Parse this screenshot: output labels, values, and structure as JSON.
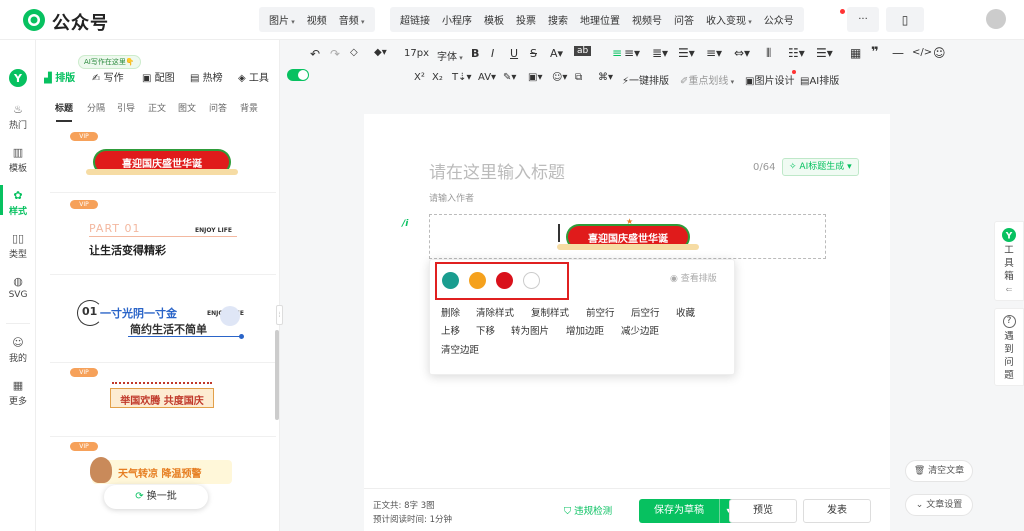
{
  "brand": {
    "name": "公众号",
    "accent": "#07c160"
  },
  "topnav": {
    "group1": [
      {
        "label": "图片",
        "caret": true
      },
      {
        "label": "视频",
        "caret": false
      },
      {
        "label": "音频",
        "caret": true
      }
    ],
    "group2": [
      "超链接",
      "小程序",
      "模板",
      "投票",
      "搜索",
      "地理位置",
      "视频号",
      "问答"
    ],
    "group2_caret": {
      "label": "收入变现"
    },
    "gzh": "公众号",
    "more": "···"
  },
  "toolbar": {
    "font_size": "17px",
    "font_family": "字体",
    "format_brush": "ab",
    "one_click": "一键排版",
    "highlight": "重点划线",
    "image_design": "图片设计",
    "ai_layout": "AI排版"
  },
  "rail": [
    {
      "label": "热门",
      "icon": "fire-icon"
    },
    {
      "label": "模板",
      "icon": "template-icon"
    },
    {
      "label": "样式",
      "icon": "style-icon",
      "active": true
    },
    {
      "label": "类型",
      "icon": "type-icon"
    },
    {
      "label": "SVG",
      "icon": "svg-icon"
    },
    {
      "label": "我的",
      "icon": "user-icon"
    },
    {
      "label": "更多",
      "icon": "more-grid-icon"
    }
  ],
  "panel": {
    "ai_bubble": "AI写作在这里👇",
    "tabs": [
      {
        "label": "排版",
        "active": true
      },
      {
        "label": "写作"
      },
      {
        "label": "配图"
      },
      {
        "label": "热榜"
      },
      {
        "label": "工具"
      }
    ],
    "subtabs": [
      {
        "label": "标题",
        "active": true
      },
      {
        "label": "分隔"
      },
      {
        "label": "引导"
      },
      {
        "label": "正文"
      },
      {
        "label": "图文"
      },
      {
        "label": "问答"
      },
      {
        "label": "背景"
      }
    ],
    "vip": "VIP",
    "cards": [
      {
        "title": "喜迎国庆盛世华诞"
      },
      {
        "part": "PART 01",
        "enjoy": "ENJOY LIFE",
        "title": "让生活变得精彩"
      },
      {
        "num": "01",
        "title": "一寸光阴一寸金",
        "enjoy": "ENJOY LIFE",
        "subtitle": "简约生活不简单"
      },
      {
        "title": "举国欢腾 共度国庆"
      },
      {
        "title": "天气转凉 降温预警"
      }
    ],
    "refresh": "换一批"
  },
  "editor": {
    "title_placeholder": "请在这里输入标题",
    "title_count": "0/64",
    "ai_title": "AI标题生成",
    "author_placeholder": "请输入作者",
    "banner": "喜迎国庆盛世华诞"
  },
  "popup": {
    "colors": [
      "#1a9d8f",
      "#f5a11d",
      "#d9111b",
      "#ffffff"
    ],
    "view_layout": "查看排版",
    "actions": [
      [
        "删除",
        "清除样式",
        "复制样式",
        "前空行",
        "后空行",
        "收藏"
      ],
      [
        "上移",
        "下移",
        "转为图片",
        "增加边距",
        "减少边距"
      ],
      [
        "清空边距"
      ]
    ]
  },
  "footer": {
    "word_label": "正文共:",
    "word_value": "8字 3图",
    "read_label": "预计阅读时间:",
    "read_value": "1分钟",
    "check": "违规检测",
    "save": "保存为草稿",
    "preview": "预览",
    "publish": "发表"
  },
  "right": {
    "toolbox": "工具箱",
    "help": "遇到问题",
    "clear": "清空文章",
    "settings": "文章设置"
  }
}
